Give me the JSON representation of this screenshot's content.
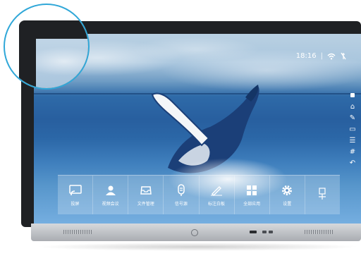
{
  "status_bar": {
    "time": "18:16",
    "separator": "|",
    "wifi_icon": "wifi-icon",
    "signal_icon": "signal-icon"
  },
  "side_toolbar": {
    "icons": [
      "tab-icon",
      "home-icon",
      "pen-icon",
      "monitor-icon",
      "list-icon",
      "grid-icon",
      "back-icon"
    ]
  },
  "dock": {
    "items": [
      {
        "label": "投屏",
        "icon": "screen-cast-icon"
      },
      {
        "label": "视频会议",
        "icon": "video-conference-icon"
      },
      {
        "label": "文件管理",
        "icon": "folder-icon"
      },
      {
        "label": "信号源",
        "icon": "signal-source-icon"
      },
      {
        "label": "标注白板",
        "icon": "whiteboard-icon"
      },
      {
        "label": "全部应用",
        "icon": "all-apps-icon"
      },
      {
        "label": "设置",
        "icon": "gear-icon"
      },
      {
        "label": "",
        "icon": "usb-icon"
      }
    ]
  },
  "colors": {
    "zoom_ring": "#2fa7d8",
    "bezel": "#1f2124",
    "chin": "#c2c5c9"
  }
}
